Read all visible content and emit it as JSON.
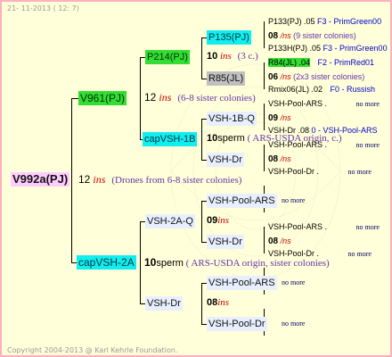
{
  "header": {
    "date": "21- 11-2013 ( 12: 7)"
  },
  "footer": {
    "copyright": "Copyright 2004-2013 @ Karl Kehrle Foundation."
  },
  "root": {
    "label": "V992a(PJ)",
    "num": "12",
    "ins": "ins",
    "note": "(Drones from 6-8 sister colonies)"
  },
  "f": {
    "label": "V961(PJ)",
    "num": "12",
    "ins": "ins",
    "note": "(6-8 sister colonies)"
  },
  "ff": {
    "label": "P214(PJ)",
    "num": "10",
    "ins": "ins",
    "note": "(3 c.)"
  },
  "fff": {
    "label": "P135(PJ)",
    "line1": "P133(PJ) .05",
    "line1b": "F3 - PrimGreen00",
    "num": "08",
    "ins": "/ns",
    "note": "(9 sister colonies)",
    "line2": "P133H(PJ) .05",
    "line2b": "F3 - PrimGreen00"
  },
  "ffd": {
    "label": "R85(JL)",
    "line1": "R84(JL) .04",
    "line1b": "F2 - PrimRed01",
    "num": "06",
    "ins": "/ns",
    "note": "(2x3 sister colonies)",
    "line2": "Rmix06(JL) .02",
    "line2b": "F0 - Russish"
  },
  "fd": {
    "label": "capVSH-1B",
    "num": "10",
    "sperm": "sperm",
    "note": "( ARS-USDA origin, c.)"
  },
  "fdf": {
    "label": "VSH-1B-Q",
    "line1": "VSH-Pool-ARS .",
    "line1b": "no more",
    "num": "09",
    "ins": "/ns",
    "line2": "VSH-Dr .08",
    "line2b": "0 - VSH-Pool-ARS"
  },
  "fdd": {
    "label": "VSH-Dr",
    "line1": "VSH-Pool-ARS .",
    "line1b": "no more",
    "num": "08",
    "ins": "/ns",
    "line2": "VSH-Pool-Dr .",
    "line2b": "no more"
  },
  "d": {
    "label": "capVSH-2A",
    "num": "10",
    "sperm": "sperm",
    "note": "( ARS-USDA origin, sister colonies)"
  },
  "df": {
    "label": "VSH-2A-Q",
    "num": "09",
    "ins": "ins"
  },
  "dff": {
    "label": "VSH-Pool-ARS",
    "nomore": "no more"
  },
  "dfd": {
    "label": "VSH-Dr",
    "line1": "VSH-Pool-ARS .",
    "line1b": "no more",
    "num": "08",
    "ins": "/ns",
    "line2": "VSH-Pool-Dr .",
    "line2b": "no more"
  },
  "dd": {
    "label": "VSH-Dr",
    "num": "08",
    "ins": "ins"
  },
  "ddf": {
    "label": "VSH-Pool-ARS",
    "nomore": "no more"
  },
  "ddd": {
    "label": "VSH-Pool-Dr",
    "nomore": "no more"
  },
  "colors": {
    "background": "#ffffd9",
    "border": "#ffb0c0",
    "green_box": "#33dd33",
    "cyan_box": "#11eeee",
    "pink_box": "#ffccff",
    "grey_box": "#c0c0c0",
    "ins": "#cc0000",
    "note": "#6633aa"
  }
}
